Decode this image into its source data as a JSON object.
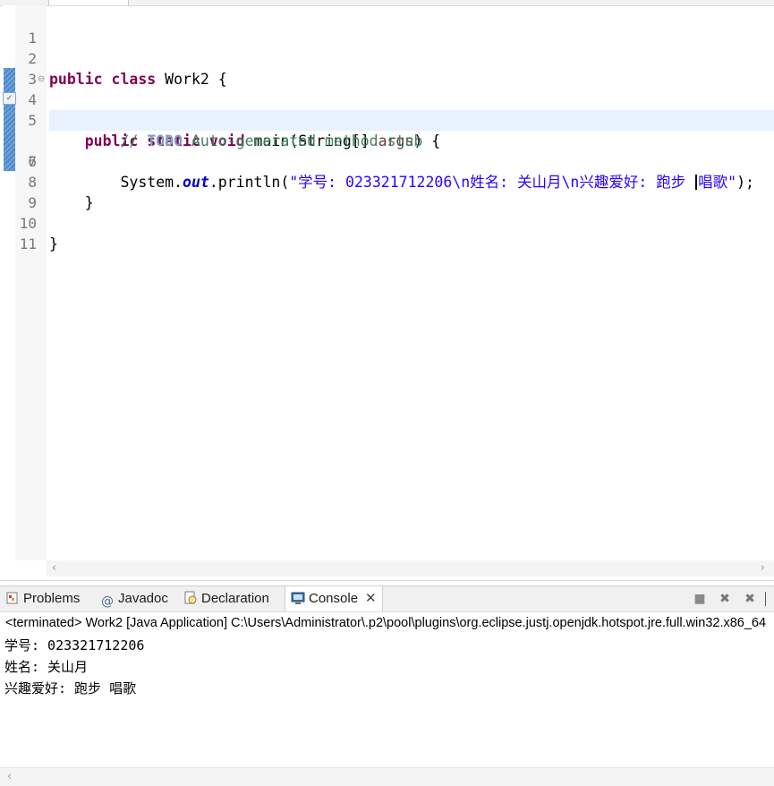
{
  "editor": {
    "lines": [
      {
        "num": "1"
      },
      {
        "num": "2",
        "t": {
          "kw1": "public",
          "kw2": "class",
          "name": " Work2 {"
        }
      },
      {
        "num": "3"
      },
      {
        "num": "4",
        "t": {
          "kw1": "public",
          "kw2": "static",
          "kw3": "void",
          "sig_a": " main(String[] ",
          "param": "args",
          "sig_b": ") {"
        }
      },
      {
        "num": "5",
        "t": {
          "comment_a": "// ",
          "todo": "TODO",
          "comment_b": " Auto-generated method stub"
        }
      },
      {
        "num": "6",
        "t": {
          "pre": "System.",
          "field": "out",
          "mid": ".println(",
          "str_a": "\"学号: 023321712206\\n姓名: 关山月\\n兴趣爱好: 跑步 ",
          "str_b": "唱歌\"",
          "end": ");"
        }
      },
      {
        "num": "7"
      },
      {
        "num": "8",
        "t": {
          "brace": "}"
        }
      },
      {
        "num": "9"
      },
      {
        "num": "10",
        "t": {
          "brace": "}"
        }
      },
      {
        "num": "11"
      }
    ],
    "fold_marker": "⊖",
    "annotation_icon": "quick-fix-icon"
  },
  "console_view": {
    "tabs": [
      {
        "label": "Problems",
        "icon": "problems-icon"
      },
      {
        "label": "Javadoc",
        "icon": "javadoc-icon"
      },
      {
        "label": "Declaration",
        "icon": "declaration-icon"
      },
      {
        "label": "Console",
        "icon": "console-icon",
        "active": true
      }
    ],
    "header": "<terminated> Work2 [Java Application] C:\\Users\\Administrator\\.p2\\pool\\plugins\\org.eclipse.justj.openjdk.hotspot.jre.full.win32.x86_64",
    "output": [
      "学号: 023321712206",
      "姓名: 关山月",
      "兴趣爱好: 跑步 唱歌"
    ],
    "toolbar_icons": [
      "terminate-icon",
      "remove-launch-icon",
      "remove-all-terminated-icon"
    ]
  },
  "colors": {
    "keyword": "#7f0055",
    "comment": "#3f7f5f",
    "string": "#2a00ff",
    "current_line": "#e8f2fe"
  }
}
